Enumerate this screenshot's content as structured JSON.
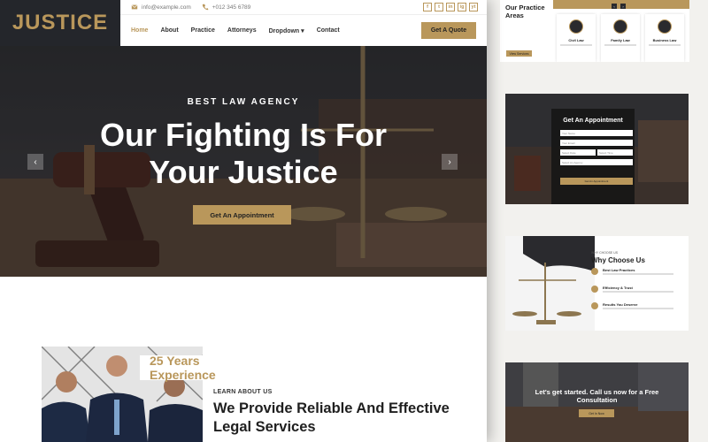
{
  "logo": "JUSTICE",
  "topbar": {
    "email": "info@example.com",
    "phone": "+012 345 6789",
    "socials": [
      "f",
      "t",
      "in",
      "ig",
      "yt"
    ]
  },
  "nav": {
    "items": [
      "Home",
      "About",
      "Practice",
      "Attorneys",
      "Dropdown",
      "Contact"
    ],
    "quote_label": "Get A Quote"
  },
  "hero": {
    "subtitle": "BEST LAW AGENCY",
    "title_line1": "Our Fighting Is For",
    "title_line2": "Your Justice",
    "button": "Get An Appointment",
    "prev": "‹",
    "next": "›"
  },
  "about": {
    "experience": "25 Years Experience",
    "label": "LEARN ABOUT US",
    "title": "We Provide Reliable And Effective Legal Services"
  },
  "preview_practice": {
    "title": "Our Practice Areas",
    "button": "View Services",
    "cards": [
      "Civil Law",
      "Family Law",
      "Business Law"
    ]
  },
  "preview_appointment": {
    "title": "Get An Appointment",
    "fields": [
      "Your Name",
      "Your Email",
      "Select Date",
      "Select Time",
      "Select An Agency"
    ],
    "button": "Get An Appointment"
  },
  "preview_why": {
    "subtitle": "WHY CHOOSE US",
    "title": "Why Choose Us",
    "items": [
      "Best Law Practices",
      "Efficiency & Trust",
      "Results You Deserve"
    ]
  },
  "preview_cta": {
    "text": "Let's get started. Call us now for a Free Consultation",
    "button": "Get In Now"
  },
  "colors": {
    "accent": "#b9975b",
    "dark": "#24262b"
  }
}
